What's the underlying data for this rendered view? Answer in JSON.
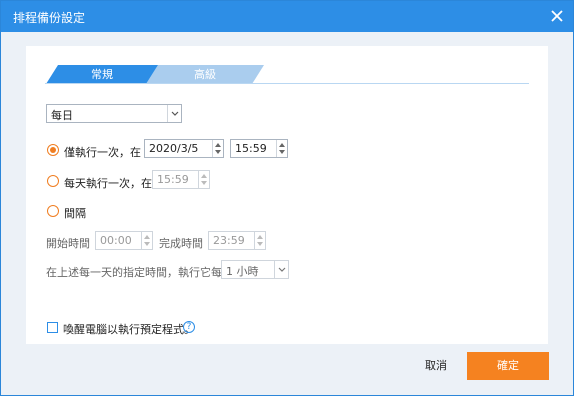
{
  "window": {
    "title": "排程備份設定",
    "close_icon": "close-icon"
  },
  "tabs": [
    {
      "label": "常規",
      "active": true
    },
    {
      "label": "高級",
      "active": false
    }
  ],
  "frequency": {
    "selected": "每日"
  },
  "options": {
    "once": {
      "label": "僅執行一次，在",
      "checked": true,
      "date": "2020/3/5",
      "time": "15:59"
    },
    "daily": {
      "label": "每天執行一次，在",
      "checked": false,
      "time": "15:59"
    },
    "interval": {
      "label": "間隔",
      "checked": false,
      "start_label": "開始時間",
      "start_time": "00:00",
      "end_label": "完成時間",
      "end_time": "23:59",
      "repeat_label": "在上述每一天的指定時間，執行它每隔",
      "repeat_value": "1 小時"
    }
  },
  "wake": {
    "label": "喚醒電腦以執行預定程式。",
    "checked": false,
    "help_icon": "question-circle-icon"
  },
  "buttons": {
    "cancel": "取消",
    "ok": "確定"
  },
  "colors": {
    "accent_blue": "#2d8ee6",
    "accent_orange": "#f58220",
    "panel_bg": "#ecf1f7"
  }
}
